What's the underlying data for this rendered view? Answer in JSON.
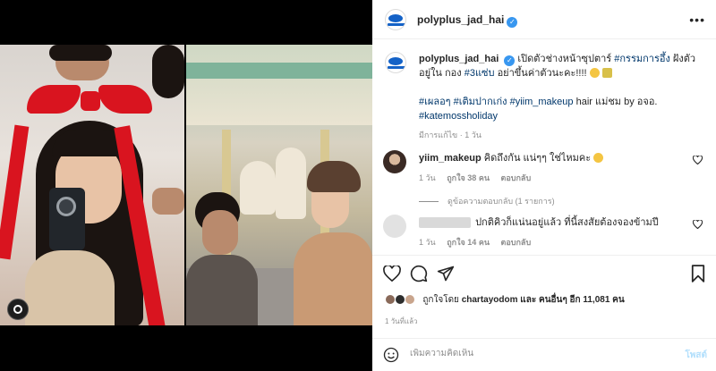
{
  "account": {
    "username": "polyplus_jad_hai",
    "verified_mark": "✓",
    "more_icon": "more-horizontal-icon"
  },
  "caption": {
    "username": "polyplus_jad_hai",
    "text_1": "เปิดตัวช่างหน้าซุปตาร์",
    "tag_1": "#กรรมการอึ้ง",
    "text_2": "ฝังตัวอยู่ใน",
    "text_3": "กอง",
    "tag_2": "#3แซ่บ",
    "text_4": "อย่าขึ้นค่าตัวนะคะ!!!!",
    "tags_line2_a": "#เผลอๆ",
    "tags_line2_b": "#เติมปากเก่ง",
    "tags_line2_c": "#yiim_makeup",
    "text_5": "hair แม่ชม by อจอ.",
    "tag_last": "#katemossholiday",
    "edited": "มีการแก้ไข",
    "age": "1 วัน"
  },
  "comments": [
    {
      "username": "yiim_makeup",
      "text": "คิดถึงกัน แน่ๆๆ ใช่ไหมคะ",
      "age": "1 วัน",
      "likes": "ถูกใจ 38 คน",
      "reply": "ตอบกลับ"
    },
    {
      "username": "",
      "text": "ปกติคิวก็แน่นอยู่แล้ว ที่นี้สงสัยต้องจองข้ามปี",
      "age": "1 วัน",
      "likes": "ถูกใจ 14 คน",
      "reply": "ตอบกลับ"
    }
  ],
  "view_replies": "ดูข้อความตอบกลับ (1 รายการ)",
  "liked_by": {
    "prefix": "ถูกใจโดย",
    "user": "chartayodom",
    "middle": "และ",
    "others": "คนอื่นๆ อีก 11,081 คน"
  },
  "time_ago": "1 วันที่แล้ว",
  "add_comment": {
    "placeholder": "เพิ่มความคิดเห็น",
    "post_label": "โพสต์"
  },
  "colors": {
    "link": "#00376b",
    "verified": "#3897f0",
    "muted": "#8e8e8e",
    "post_disabled": "#b2dffc"
  }
}
